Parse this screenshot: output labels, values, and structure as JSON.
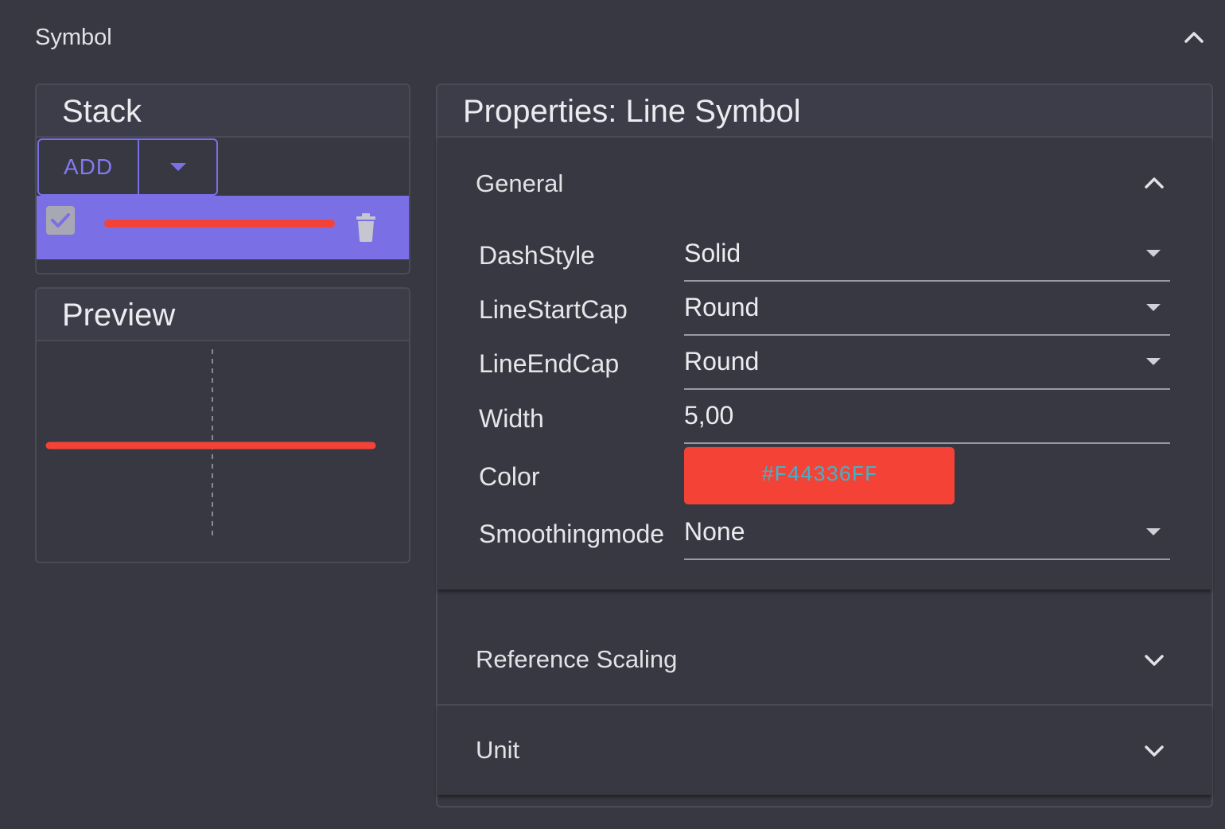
{
  "section": {
    "title": "Symbol",
    "collapse_icon": "chevron-up-icon"
  },
  "stack": {
    "title": "Stack",
    "add_label": "ADD",
    "add_dropdown_icon": "caret-down-icon",
    "layers": [
      {
        "checked": true,
        "line_color": "#F44336",
        "delete_icon": "trash-icon"
      }
    ]
  },
  "preview": {
    "title": "Preview",
    "line_color": "#F44336"
  },
  "properties": {
    "title": "Properties: Line Symbol",
    "general": {
      "title": "General",
      "expanded": true,
      "fields": {
        "dash_style": {
          "label": "DashStyle",
          "value": "Solid"
        },
        "line_start_cap": {
          "label": "LineStartCap",
          "value": "Round"
        },
        "line_end_cap": {
          "label": "LineEndCap",
          "value": "Round"
        },
        "width": {
          "label": "Width",
          "value": "5,00"
        },
        "color": {
          "label": "Color",
          "value": "#F44336FF"
        },
        "smoothing_mode": {
          "label": "Smoothingmode",
          "value": "None"
        }
      }
    },
    "reference_scaling": {
      "title": "Reference Scaling",
      "expanded": false
    },
    "unit": {
      "title": "Unit",
      "expanded": false
    }
  },
  "colors": {
    "accent": "#7B6FE6",
    "symbol_red": "#F44336",
    "background": "#383842"
  }
}
